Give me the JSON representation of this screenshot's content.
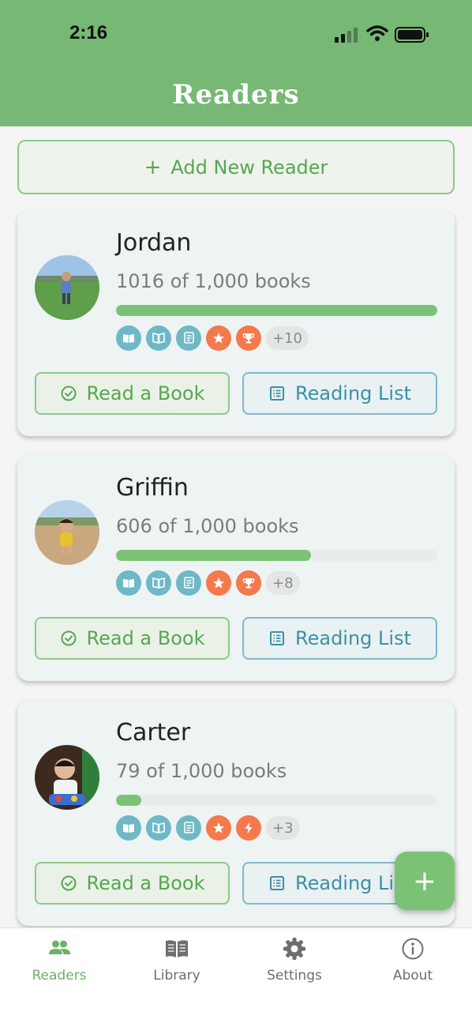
{
  "status_bar": {
    "time": "2:16"
  },
  "header": {
    "title": "Readers"
  },
  "add_reader": {
    "icon": "+",
    "label": "Add New Reader"
  },
  "readers": [
    {
      "name": "Jordan",
      "books_text": "1016 of 1,000 books",
      "progress": 1.0,
      "badges": [
        "book-open-icon",
        "book-icon",
        "list-icon",
        "star-icon",
        "trophy-icon"
      ],
      "more": "+10",
      "read_label": "Read a Book",
      "list_label": "Reading List"
    },
    {
      "name": "Griffin",
      "books_text": "606 of 1,000 books",
      "progress": 0.606,
      "badges": [
        "book-open-icon",
        "book-icon",
        "list-icon",
        "star-icon",
        "trophy-icon"
      ],
      "more": "+8",
      "read_label": "Read a Book",
      "list_label": "Reading List"
    },
    {
      "name": "Carter",
      "books_text": "79 of 1,000 books",
      "progress": 0.079,
      "badges": [
        "book-open-icon",
        "book-icon",
        "list-icon",
        "star-icon",
        "lightning-icon"
      ],
      "more": "+3",
      "read_label": "Read a Book",
      "list_label": "Reading List"
    }
  ],
  "fab": {
    "icon": "+"
  },
  "tabs": [
    {
      "label": "Readers",
      "icon": "people-icon",
      "active": true
    },
    {
      "label": "Library",
      "icon": "library-book-icon",
      "active": false
    },
    {
      "label": "Settings",
      "icon": "gear-icon",
      "active": false
    },
    {
      "label": "About",
      "icon": "info-icon",
      "active": false
    }
  ],
  "colors": {
    "header": "#76b874",
    "accent_green": "#57a653",
    "accent_blue": "#3d8fa6",
    "badge_blue": "#6fb8c6",
    "badge_orange": "#f4794c"
  }
}
